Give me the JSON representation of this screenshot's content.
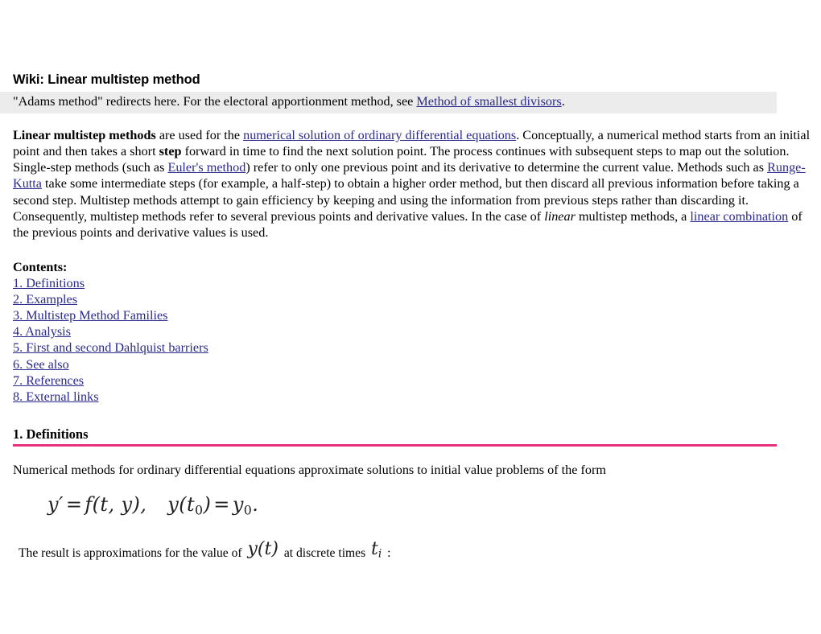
{
  "document": {
    "title": "Wiki: Linear multistep method",
    "hatnote": {
      "before_link": "\"Adams method\" redirects here. For the electoral apportionment method, see ",
      "link_text": "Method of smallest divisors",
      "after_link": "."
    },
    "lead": {
      "bold_term": "Linear multistep methods",
      "seg1": " are used for the ",
      "link1": "numerical solution of ordinary differential equations",
      "seg2": ". Conceptually, a numerical method starts from an initial point and then takes a short ",
      "bold_step": "step",
      "seg3": " forward in time to find the next solution point. The process continues with subsequent steps to map out the solution. Single-step methods (such as ",
      "link2": "Euler's method",
      "seg4": ") refer to only one previous point and its derivative to determine the current value. Methods such as ",
      "link3": "Runge-Kutta",
      "seg5": " take some intermediate steps (for example, a half-step) to obtain a higher order method, but then discard all previous information before taking a second step. Multistep methods attempt to gain efficiency by keeping and using the information from previous steps rather than discarding it. Consequently, multistep methods refer to several previous points and derivative values. In the case of ",
      "italic_linear": "linear",
      "seg6": " multistep methods, a ",
      "link4": "linear combination",
      "seg7": " of the previous points and derivative values is used."
    },
    "contents": {
      "heading": "Contents:",
      "items": [
        "1. Definitions",
        "2. Examples",
        "3. Multistep Method Families",
        "4. Analysis",
        "5. First and second Dahlquist barriers",
        "6. See also",
        "7. References",
        "8. External links"
      ]
    },
    "section": {
      "heading": "1. Definitions",
      "rule_color": "#e8327c",
      "paragraph": "Numerical methods for ordinary differential equations approximate solutions to initial value problems of the form",
      "equation": {
        "lhs_y": "y",
        "prime": "′",
        "eq1": "=",
        "f": "f",
        "args": "(t, y),",
        "y2": "y",
        "open": "(",
        "t": "t",
        "t_sub": "0",
        "close": ")",
        "eq2": "=",
        "y3": "y",
        "y_sub": "0",
        "period": "."
      },
      "result_before": "The result is approximations for the value of ",
      "result_math_yt": "y(t)",
      "result_middle": " at discrete times ",
      "result_math_ti_base": "t",
      "result_math_ti_sub": "i",
      "result_after": " :"
    },
    "colors": {
      "link": "#2a2a8c",
      "hatnote_background": "#ececec",
      "section_rule": "#e8327c",
      "text": "#000000"
    }
  }
}
